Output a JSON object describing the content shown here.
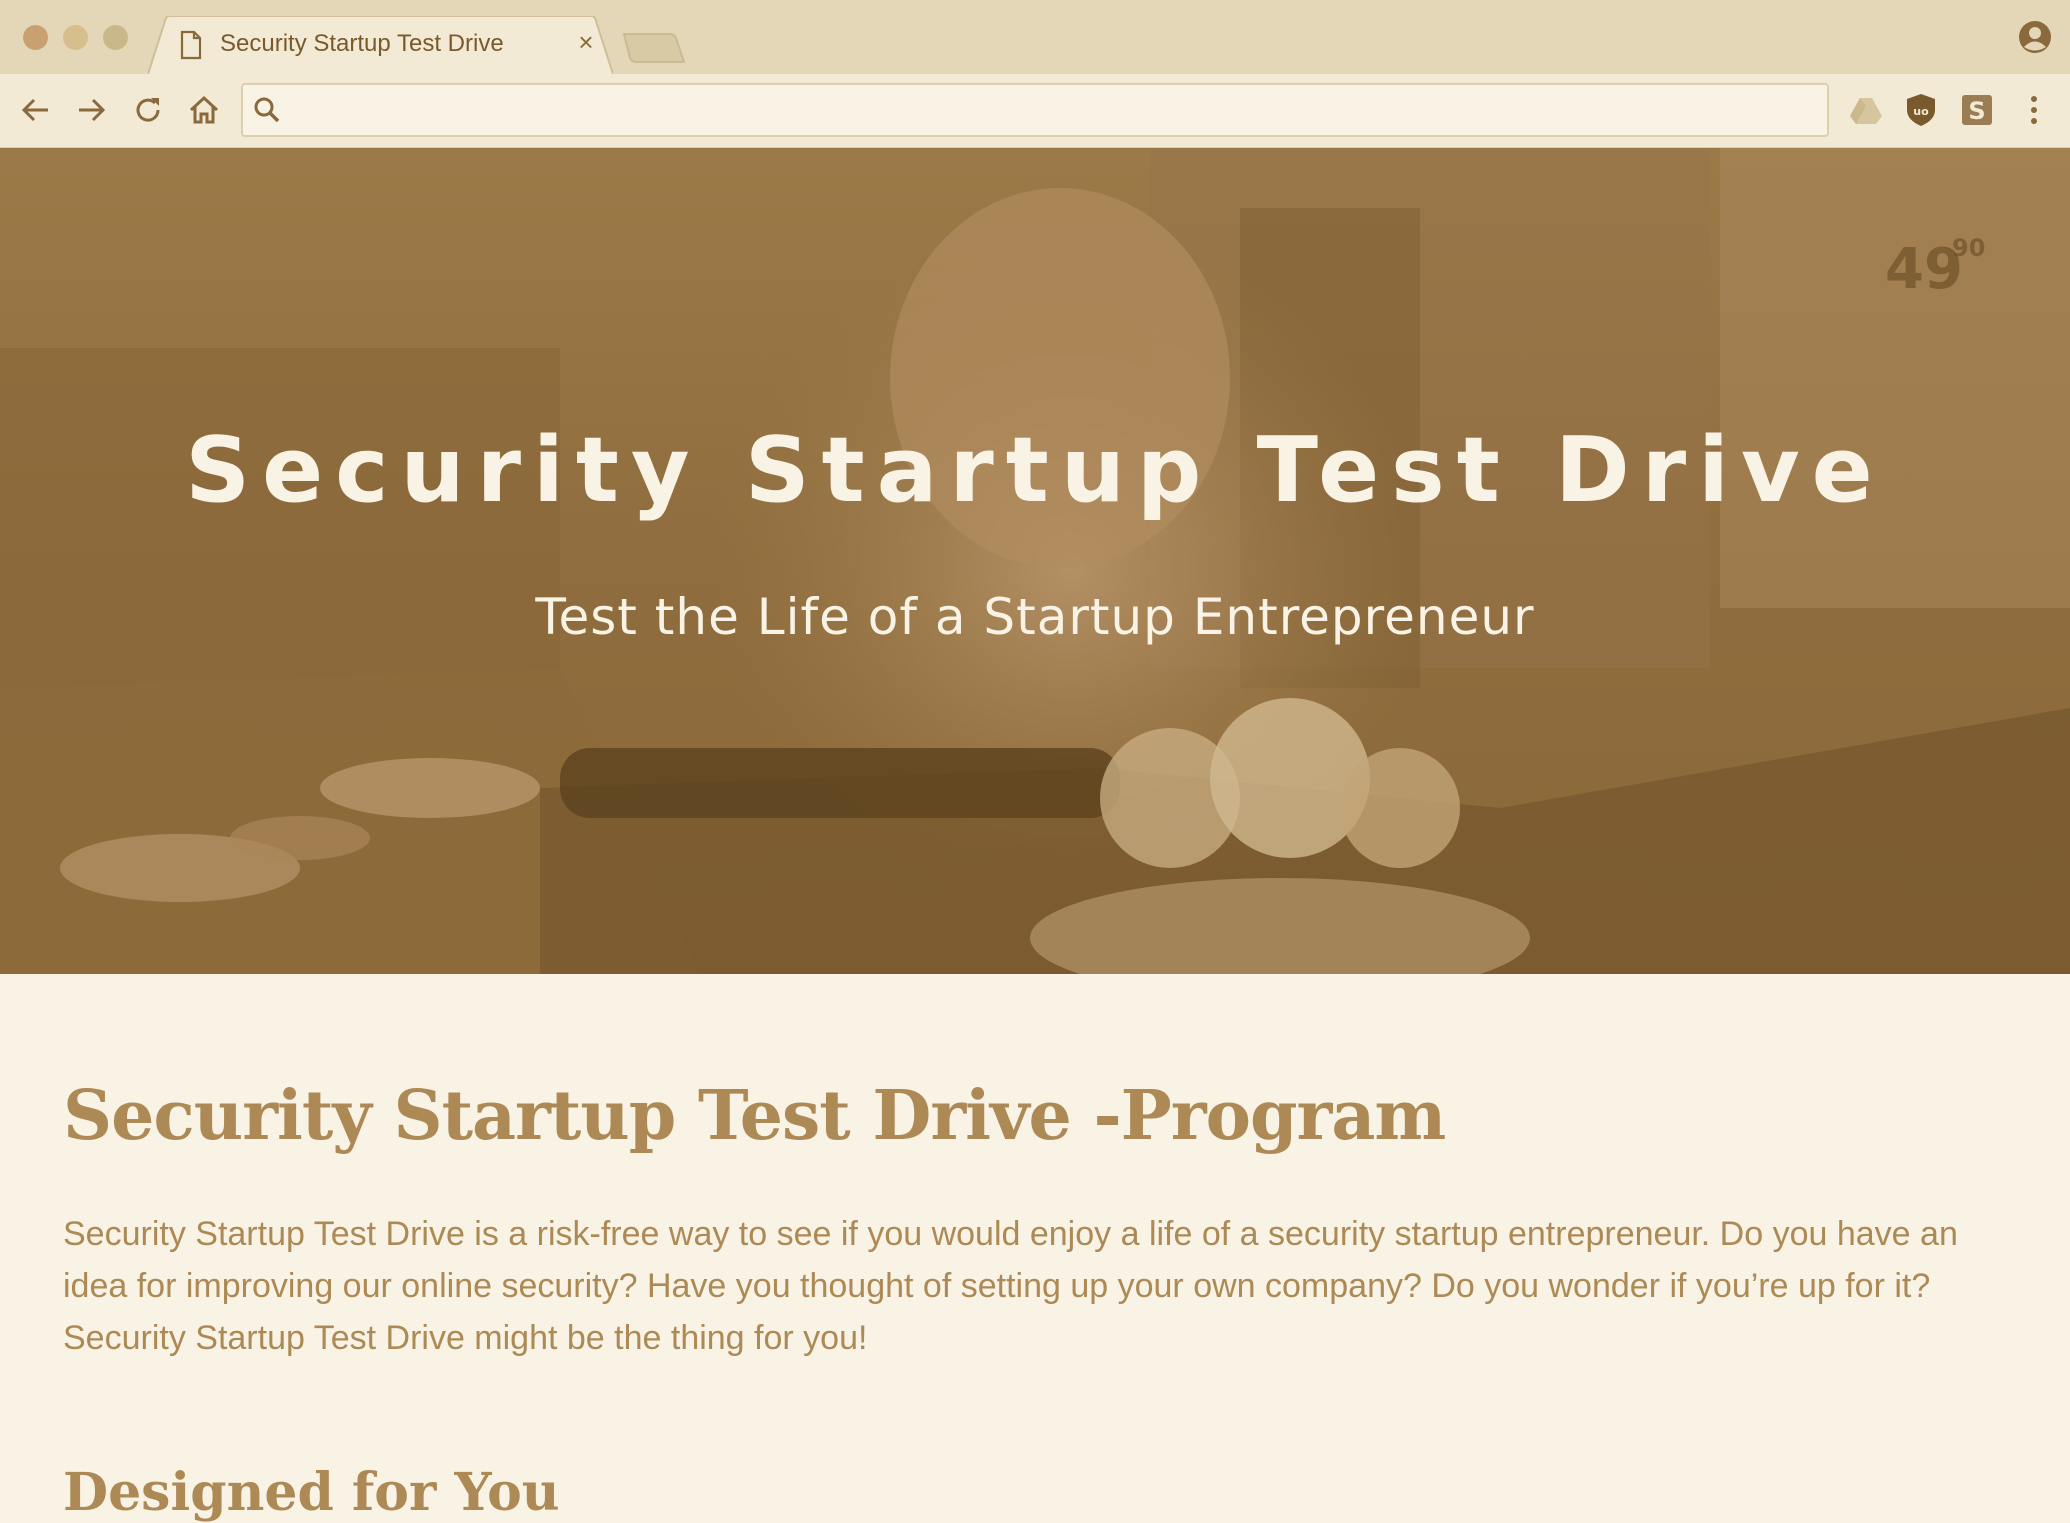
{
  "browser": {
    "tab_title": "Security Startup Test Drive",
    "tab_close_glyph": "×",
    "address_value": "",
    "icons": [
      "document-icon",
      "close-icon",
      "new-tab-icon",
      "profile-icon",
      "back-icon",
      "forward-icon",
      "reload-icon",
      "home-icon",
      "search-icon",
      "google-drive-extension-icon",
      "ublock-extension-icon",
      "s-extension-icon",
      "more-menu-icon"
    ]
  },
  "hero": {
    "title": "Security Startup Test Drive",
    "subtitle": "Test the Life of a Startup Entrepreneur",
    "price_sign": "49",
    "price_cents": "90"
  },
  "content": {
    "heading": "Security Startup Test Drive -Program",
    "paragraph": "Security Startup Test Drive is a risk-free way to see if you would enjoy a life of a security startup entrepreneur. Do you have an idea for improving our online security? Have you thought of setting up your own company? Do you wonder if you’re up for it? Security Startup Test Drive might be the thing for you!",
    "subheading": "Designed for You"
  },
  "colors": {
    "page_bg": "#f8f3e5",
    "chrome_bg": "#e3d7b7",
    "accent_text": "#ad8a55",
    "hero_overlay": "#a07c4a"
  }
}
